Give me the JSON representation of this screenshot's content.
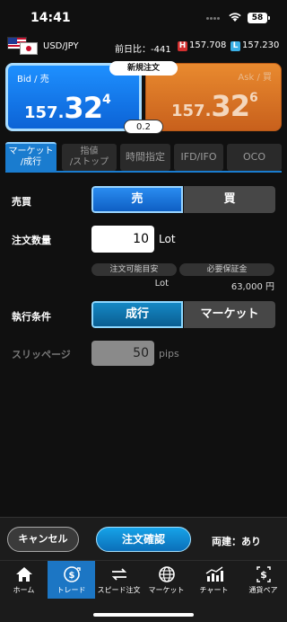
{
  "status": {
    "time": "14:41",
    "battery": "58"
  },
  "pair": {
    "name": "USD/JPY",
    "prev_label": "前日比：",
    "prev_value": "-441",
    "high_badge": "H",
    "high": "157.708",
    "low_badge": "L",
    "low": "157.230"
  },
  "quote": {
    "order_label": "新規注文",
    "bid_label": "Bid / 売",
    "bid_small": "157.",
    "bid_big": "32",
    "bid_sup": "4",
    "ask_label": "Ask / 買",
    "ask_small": "157.",
    "ask_big": "32",
    "ask_sup": "6",
    "spread": "0.2"
  },
  "tabs": [
    {
      "line1": "マーケット",
      "line2": "/成行"
    },
    {
      "line1": "指値",
      "line2": "/ストップ"
    },
    {
      "label": "時間指定"
    },
    {
      "label": "IFD/IFO"
    },
    {
      "label": "OCO"
    }
  ],
  "form": {
    "side_label": "売買",
    "sell": "売",
    "buy": "買",
    "qty_label": "注文数量",
    "qty_value": "10",
    "qty_unit": "Lot",
    "avail_label": "注文可能目安",
    "avail_value": "Lot",
    "margin_label": "必要保証金",
    "margin_value": "63,000 円",
    "exec_label": "執行条件",
    "exec_on": "成行",
    "exec_off": "マーケット",
    "slip_label": "スリッページ",
    "slip_value": "50",
    "slip_unit": "pips"
  },
  "bottom": {
    "cancel": "キャンセル",
    "confirm": "注文確認",
    "hedge": "両建：あり"
  },
  "tabbar": [
    {
      "label": "ホーム",
      "icon": "home-icon"
    },
    {
      "label": "トレード",
      "icon": "trade-icon"
    },
    {
      "label": "スピード注文",
      "icon": "speed-order-icon"
    },
    {
      "label": "マーケット",
      "icon": "globe-icon"
    },
    {
      "label": "チャート",
      "icon": "chart-icon"
    },
    {
      "label": "通貨ペア",
      "icon": "currency-pair-icon"
    }
  ],
  "colors": {
    "bid": "#1e90ff",
    "ask": "#e98a2f",
    "active_tab": "#1a7ccf"
  }
}
